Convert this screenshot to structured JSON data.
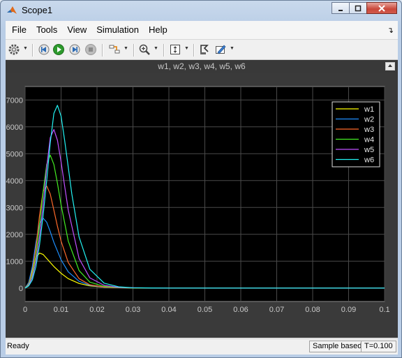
{
  "window": {
    "title": "Scope1"
  },
  "menu": [
    "File",
    "Tools",
    "View",
    "Simulation",
    "Help"
  ],
  "toolbar": [
    "gear-icon",
    "step-back-icon",
    "run-icon",
    "step-forward-icon",
    "stop-icon",
    "highlight-block-icon",
    "zoom-icon",
    "scale-axes-icon",
    "signal-select-icon",
    "style-icon"
  ],
  "scope": {
    "title": "w1, w2, w3, w4, w5, w6"
  },
  "status": {
    "left": "Ready",
    "mode": "Sample based",
    "time": "T=0.100"
  },
  "colors": {
    "w1": "#ffff00",
    "w2": "#1e90ff",
    "w3": "#ff6a2a",
    "w4": "#44ee22",
    "w5": "#c050ff",
    "w6": "#22f2f2"
  },
  "chart_data": {
    "type": "line",
    "title": "w1, w2, w3, w4, w5, w6",
    "xlim": [
      0,
      0.1
    ],
    "ylim": [
      -500,
      7500
    ],
    "xticks": [
      "0",
      "0.01",
      "0.02",
      "0.03",
      "0.04",
      "0.05",
      "0.06",
      "0.07",
      "0.08",
      "0.09",
      "0.1"
    ],
    "yticks": [
      "0",
      "1000",
      "2000",
      "3000",
      "4000",
      "5000",
      "6000",
      "7000"
    ],
    "grid": true,
    "legend": "top-right",
    "series": [
      {
        "name": "w1",
        "x": [
          0,
          0.001,
          0.002,
          0.003,
          0.004,
          0.005,
          0.006,
          0.008,
          0.01,
          0.012,
          0.015,
          0.018,
          0.022,
          0.026,
          0.03,
          0.035,
          0.04,
          0.05,
          0.1
        ],
        "y": [
          0,
          200,
          700,
          1150,
          1300,
          1250,
          1100,
          800,
          550,
          350,
          170,
          80,
          30,
          10,
          4,
          1,
          0,
          0,
          0
        ]
      },
      {
        "name": "w2",
        "x": [
          0,
          0.001,
          0.002,
          0.003,
          0.004,
          0.005,
          0.006,
          0.007,
          0.008,
          0.01,
          0.012,
          0.015,
          0.018,
          0.022,
          0.026,
          0.03,
          0.035,
          0.04,
          0.1
        ],
        "y": [
          0,
          200,
          800,
          1700,
          2400,
          2600,
          2450,
          2100,
          1700,
          1050,
          600,
          250,
          100,
          30,
          10,
          4,
          1,
          0,
          0
        ]
      },
      {
        "name": "w3",
        "x": [
          0,
          0.001,
          0.002,
          0.003,
          0.004,
          0.005,
          0.006,
          0.007,
          0.008,
          0.009,
          0.01,
          0.012,
          0.015,
          0.018,
          0.022,
          0.026,
          0.03,
          0.035,
          0.04,
          0.1
        ],
        "y": [
          0,
          150,
          600,
          1500,
          2700,
          3600,
          3800,
          3500,
          2900,
          2300,
          1750,
          950,
          350,
          120,
          35,
          10,
          4,
          1,
          0,
          0
        ]
      },
      {
        "name": "w4",
        "x": [
          0,
          0.001,
          0.002,
          0.003,
          0.004,
          0.005,
          0.006,
          0.007,
          0.008,
          0.009,
          0.01,
          0.012,
          0.015,
          0.018,
          0.022,
          0.026,
          0.03,
          0.035,
          0.04,
          0.1
        ],
        "y": [
          0,
          120,
          500,
          1200,
          2300,
          3600,
          4600,
          4950,
          4600,
          3900,
          3100,
          1750,
          650,
          220,
          60,
          15,
          5,
          1,
          0,
          0
        ]
      },
      {
        "name": "w5",
        "x": [
          0,
          0.001,
          0.002,
          0.003,
          0.004,
          0.005,
          0.006,
          0.007,
          0.008,
          0.009,
          0.01,
          0.011,
          0.012,
          0.015,
          0.018,
          0.022,
          0.026,
          0.03,
          0.035,
          0.04,
          0.1
        ],
        "y": [
          0,
          100,
          400,
          1000,
          1900,
          3100,
          4500,
          5600,
          5900,
          5500,
          4700,
          3800,
          2900,
          1100,
          380,
          100,
          25,
          8,
          2,
          0,
          0
        ]
      },
      {
        "name": "w6",
        "x": [
          0,
          0.001,
          0.002,
          0.003,
          0.004,
          0.005,
          0.006,
          0.007,
          0.008,
          0.009,
          0.01,
          0.011,
          0.012,
          0.013,
          0.015,
          0.018,
          0.022,
          0.026,
          0.03,
          0.035,
          0.04,
          0.1
        ],
        "y": [
          0,
          80,
          300,
          800,
          1600,
          2700,
          4000,
          5400,
          6500,
          6800,
          6400,
          5500,
          4500,
          3500,
          1900,
          700,
          180,
          45,
          12,
          3,
          0,
          0
        ]
      }
    ]
  }
}
